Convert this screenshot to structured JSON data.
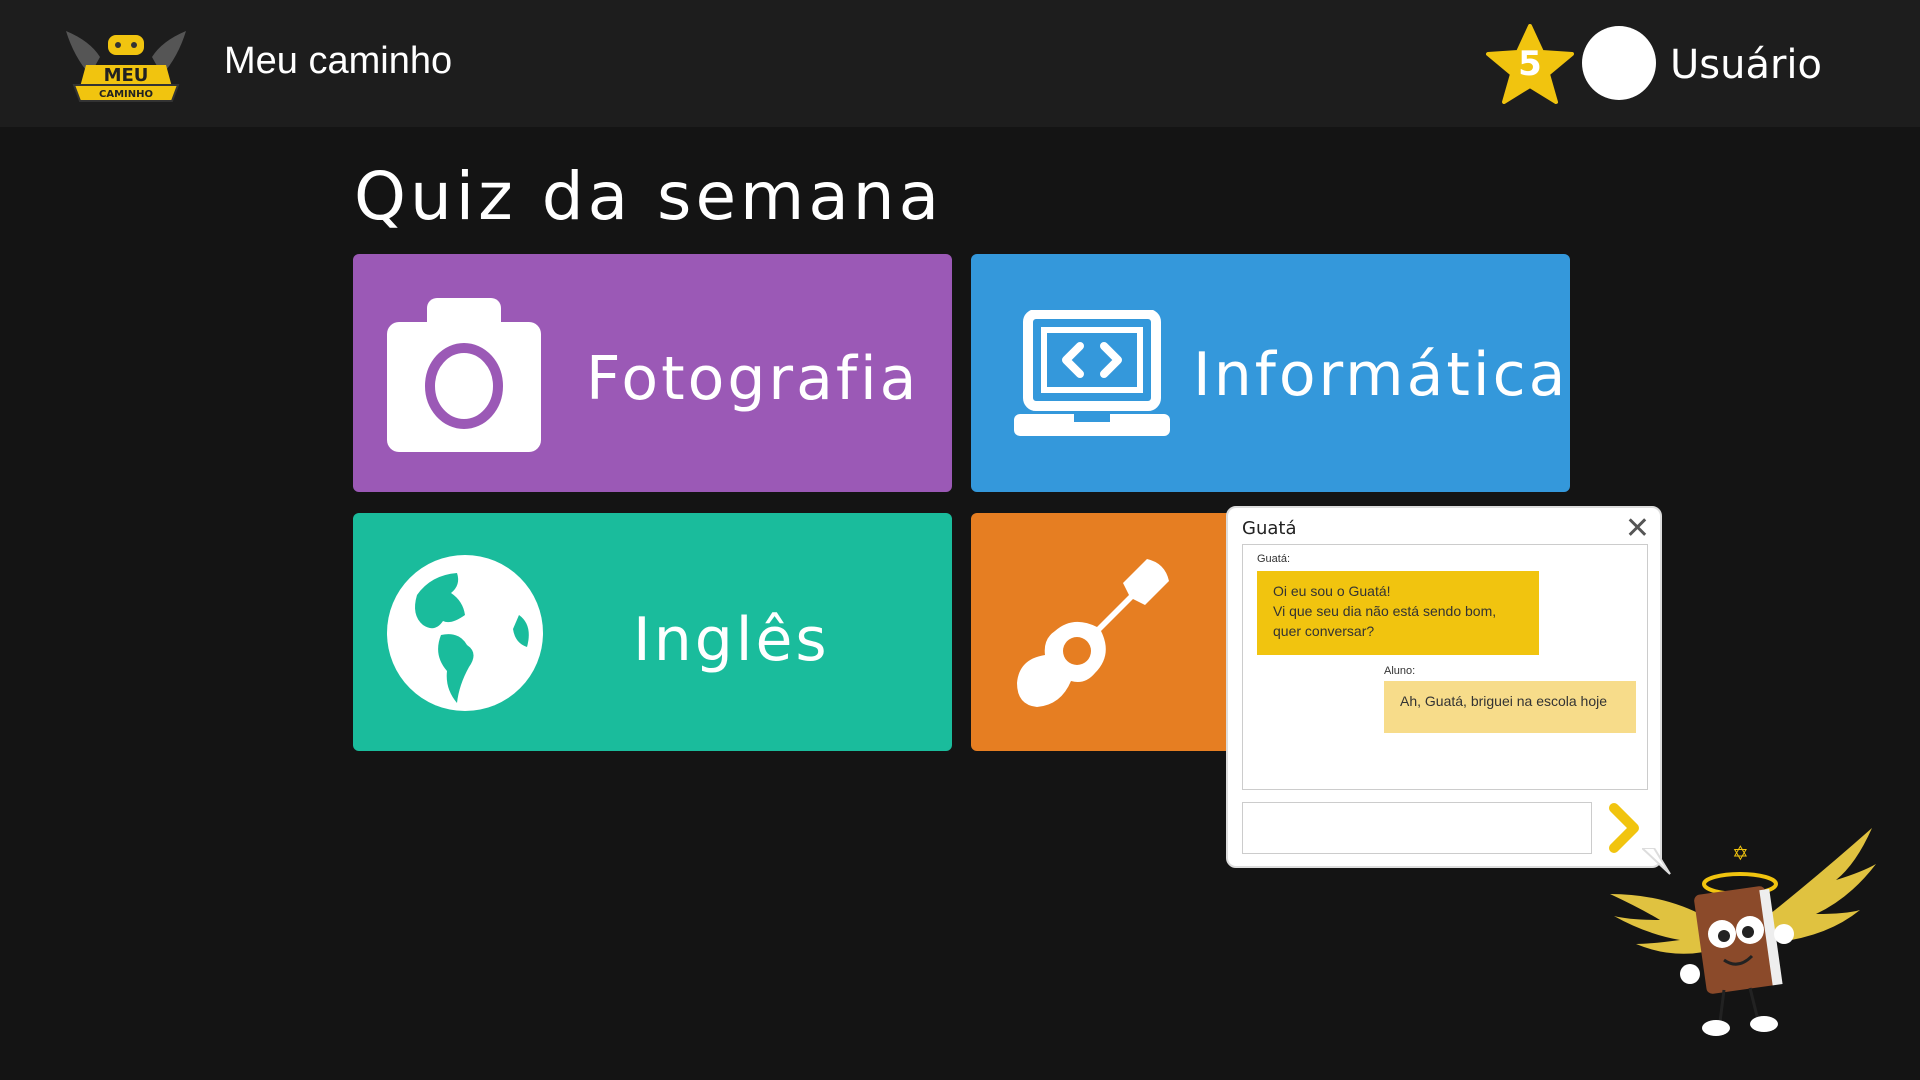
{
  "header": {
    "logo_text_top": "MEU",
    "logo_text_bottom": "CAMINHO",
    "app_title": "Meu caminho",
    "stars": "5",
    "user_name": "Usuário"
  },
  "main": {
    "section_title": "Quiz da semana",
    "tiles": [
      {
        "label": "Fotografia",
        "icon": "camera-icon",
        "color": "#9b59b6"
      },
      {
        "label": "Informática",
        "icon": "laptop-code-icon",
        "color": "#3498db"
      },
      {
        "label": "Inglês",
        "icon": "globe-icon",
        "color": "#1abc9c"
      },
      {
        "label": "",
        "icon": "guitar-icon",
        "color": "#e67e22"
      }
    ]
  },
  "chat": {
    "title": "Guatá",
    "close_icon": "close-icon",
    "messages": [
      {
        "from": "Guatá:",
        "text": "Oi eu sou o Guatá!\nVi que seu dia não está sendo bom, quer conversar?"
      },
      {
        "from": "Aluno:",
        "text": "Ah, Guatá, briguei na escola hoje"
      }
    ],
    "input_value": "",
    "send_icon": "chevron-right-icon",
    "accent": "#f1c40f"
  },
  "mascot": {
    "icon": "winged-book-mascot-icon",
    "seal_letters": "✡"
  }
}
